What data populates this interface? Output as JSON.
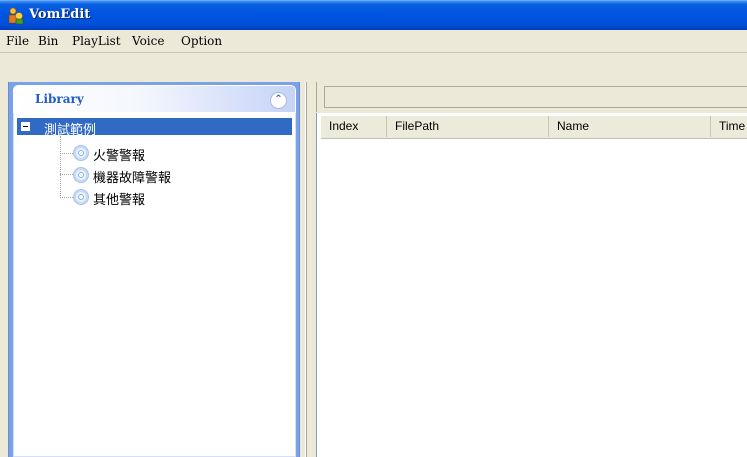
{
  "window": {
    "title": "VomEdit"
  },
  "menu": [
    "File",
    "Bin",
    "PlayList",
    "Voice",
    "Option"
  ],
  "library": {
    "title": "Library",
    "root": "測試範例",
    "items": [
      "火警警報",
      "機器故障警報",
      "其他警報"
    ]
  },
  "playlist": {
    "columns": [
      "Index",
      "FilePath",
      "Name",
      "Time"
    ]
  }
}
